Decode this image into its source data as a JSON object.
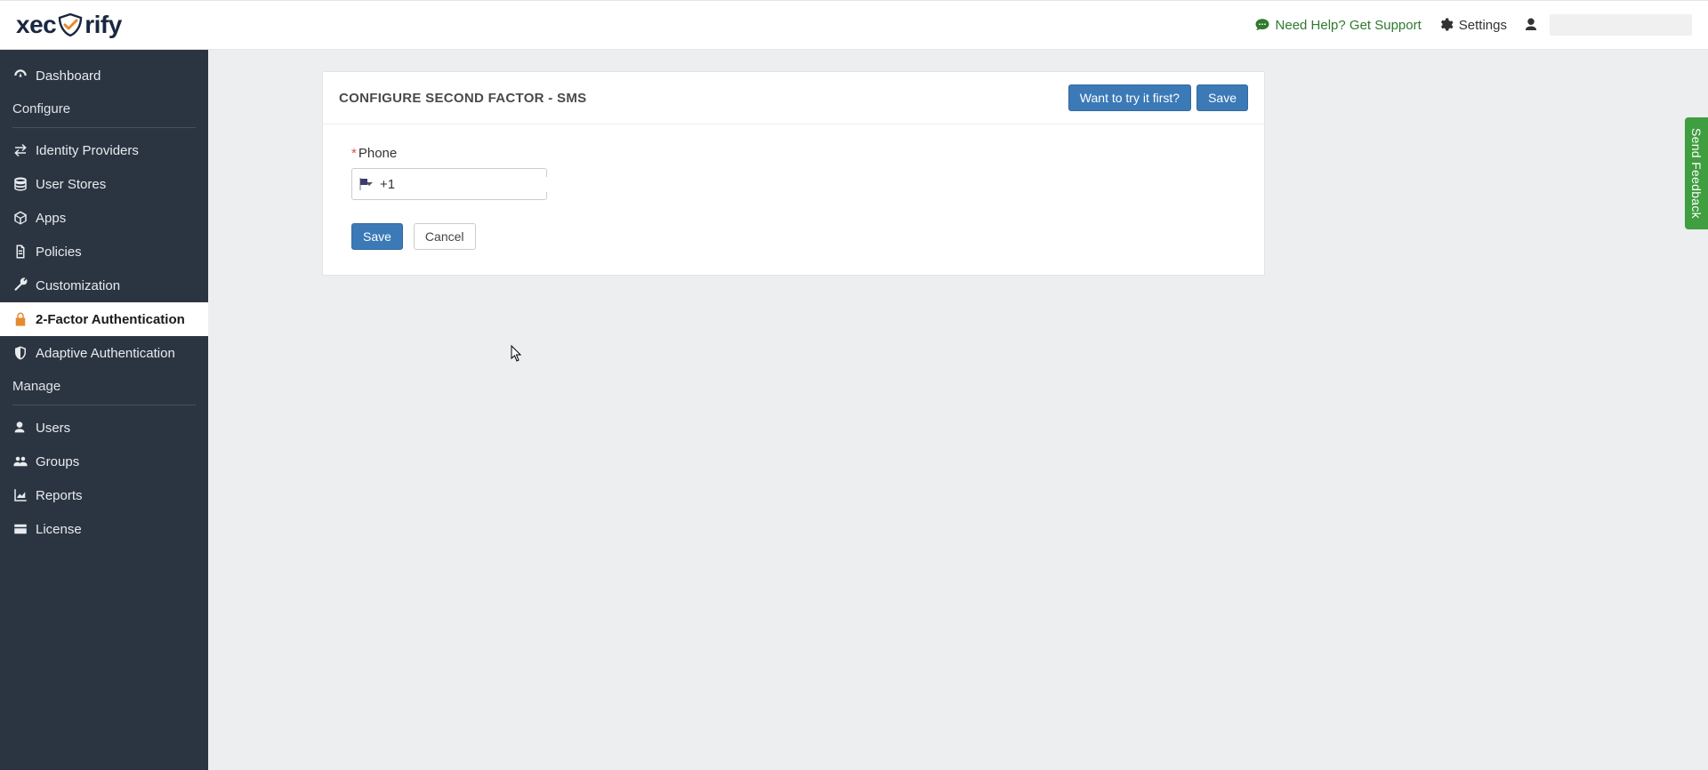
{
  "brand": {
    "pre": "xec",
    "post": "rify"
  },
  "topbar": {
    "help_label": "Need Help? Get Support",
    "settings_label": "Settings"
  },
  "sidebar": {
    "dashboard": "Dashboard",
    "section_configure": "Configure",
    "identity_providers": "Identity Providers",
    "user_stores": "User Stores",
    "apps": "Apps",
    "policies": "Policies",
    "customization": "Customization",
    "two_factor": "2-Factor Authentication",
    "adaptive_auth": "Adaptive Authentication",
    "section_manage": "Manage",
    "users": "Users",
    "groups": "Groups",
    "reports": "Reports",
    "license": "License"
  },
  "panel": {
    "title": "CONFIGURE SECOND FACTOR - SMS",
    "try_first_label": "Want to try it first?",
    "save_label": "Save"
  },
  "form": {
    "phone_label": "Phone",
    "phone_prefix": "+1",
    "save_label": "Save",
    "cancel_label": "Cancel"
  },
  "feedback": {
    "label": "Send Feedback"
  }
}
